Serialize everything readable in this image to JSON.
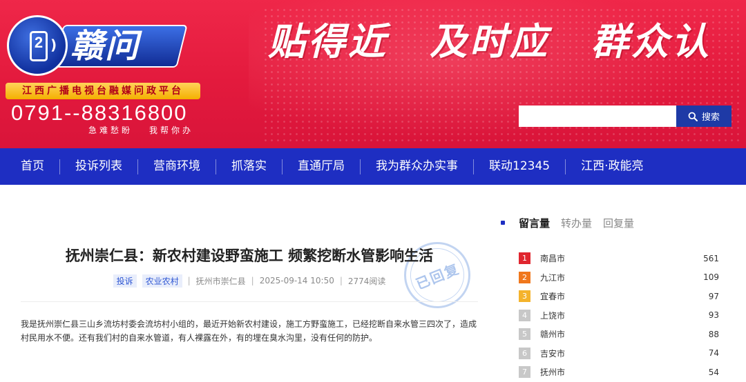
{
  "banner": {
    "logo_text": "赣问",
    "logo_number": "2",
    "slogans": [
      "贴得近",
      "及时应",
      "群众认"
    ],
    "platform_tag": "江西广播电视台融媒问政平台",
    "hotline": "0791--88316800",
    "hotline_sub": [
      "急难愁盼",
      "我帮你办"
    ]
  },
  "search": {
    "placeholder": "",
    "button_label": "搜索"
  },
  "nav": {
    "items": [
      "首页",
      "投诉列表",
      "营商环境",
      "抓落实",
      "直通厅局",
      "我为群众办实事",
      "联动12345",
      "江西·政能亮"
    ]
  },
  "article": {
    "title": "抚州崇仁县：新农村建设野蛮施工 频繁挖断水管影响生活",
    "tags": [
      "投诉",
      "农业农村"
    ],
    "location": "抚州市崇仁县",
    "datetime": "2025-09-14 10:50",
    "reads": "2774阅读",
    "stamp": "已回复",
    "content": "我是抚州崇仁县三山乡流坊村委会流坊村小组的，最近开始新农村建设，施工方野蛮施工，已经挖断自来水管三四次了，造成村民用水不便。还有我们村的自来水管道，有人裸露在外，有的埋在臭水沟里，没有任何的防护。"
  },
  "sidebar": {
    "tabs": [
      "留言量",
      "转办量",
      "回复量"
    ],
    "active_tab": "留言量",
    "ranking": [
      {
        "rank": "1",
        "city": "南昌市",
        "count": "561",
        "color": "#e0262f"
      },
      {
        "rank": "2",
        "city": "九江市",
        "count": "109",
        "color": "#f0771c"
      },
      {
        "rank": "3",
        "city": "宜春市",
        "count": "97",
        "color": "#f4b32c"
      },
      {
        "rank": "4",
        "city": "上饶市",
        "count": "93",
        "color": "#c8c8c8"
      },
      {
        "rank": "5",
        "city": "赣州市",
        "count": "88",
        "color": "#c8c8c8"
      },
      {
        "rank": "6",
        "city": "吉安市",
        "count": "74",
        "color": "#c8c8c8"
      },
      {
        "rank": "7",
        "city": "抚州市",
        "count": "54",
        "color": "#c8c8c8"
      }
    ]
  }
}
